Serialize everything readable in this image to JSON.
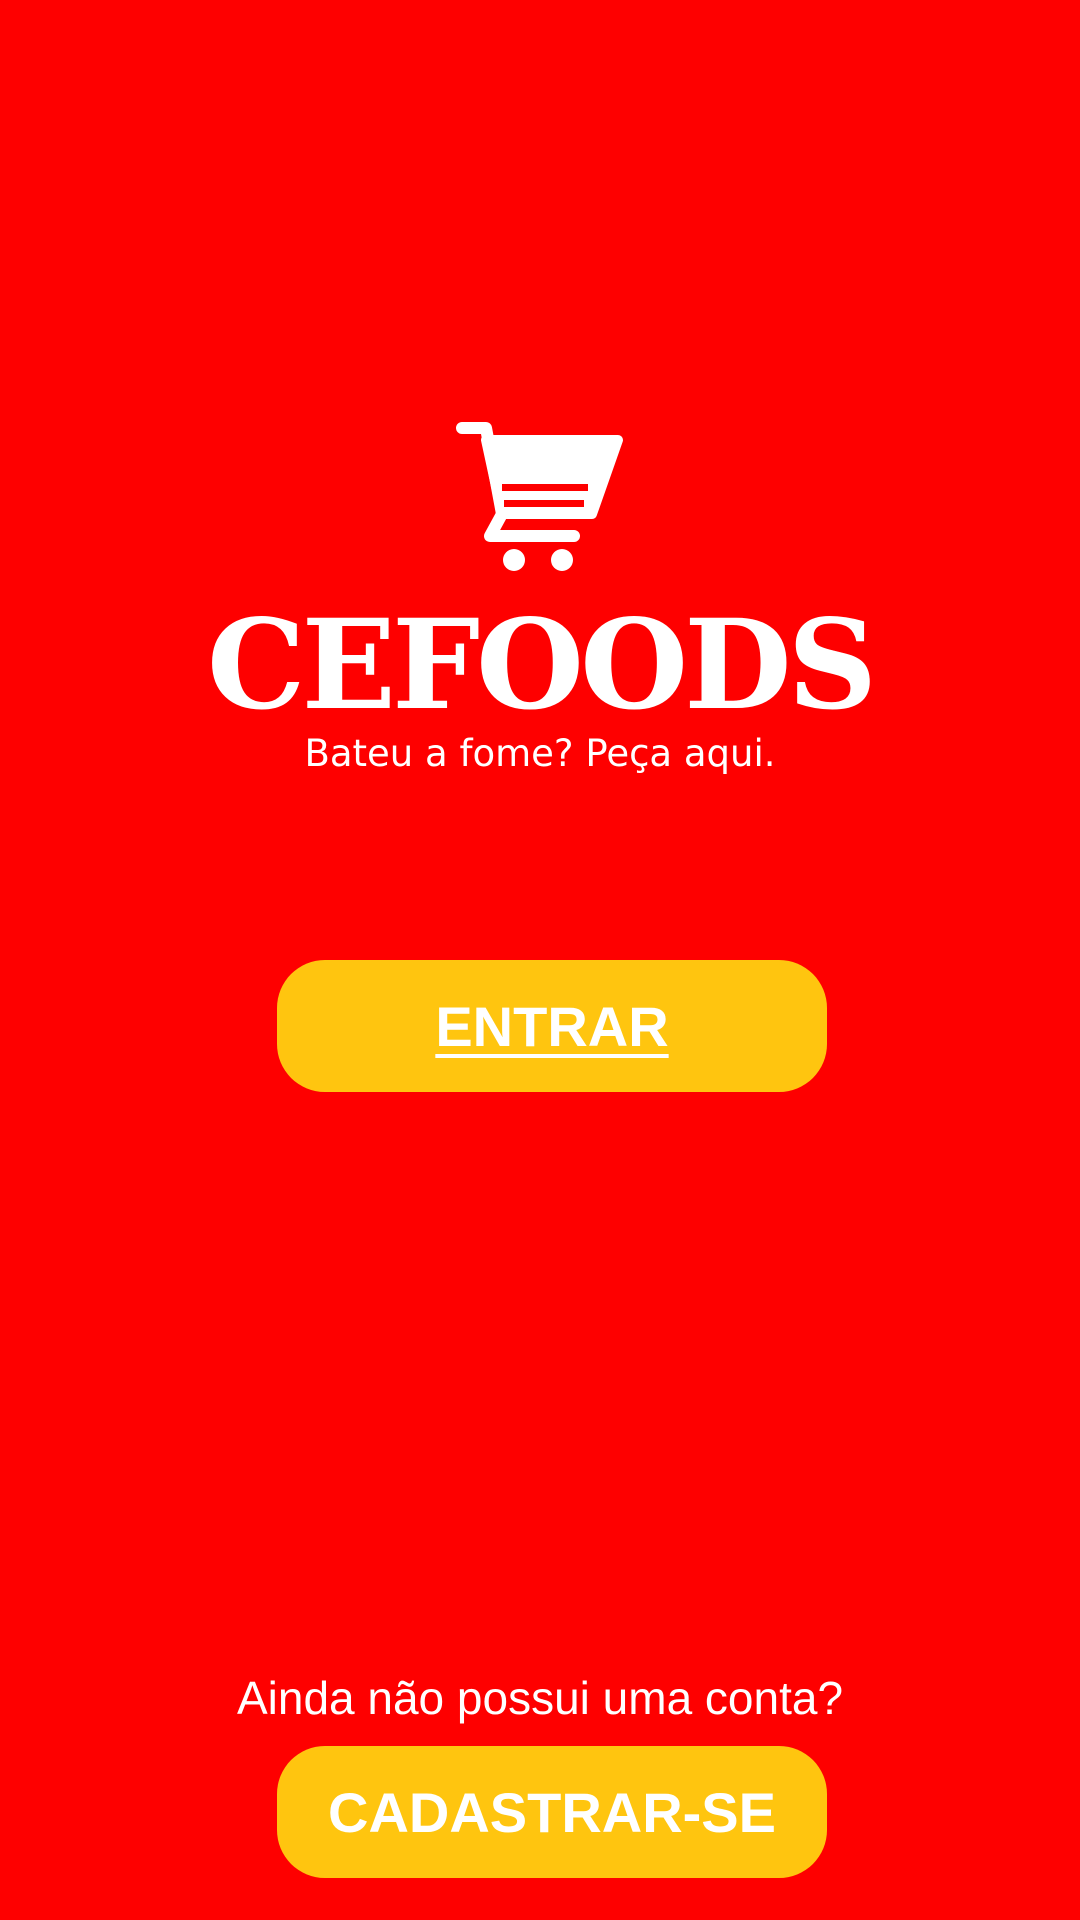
{
  "brand": {
    "name": "CEFOODS",
    "tagline": "Bateu a fome? Peça aqui.",
    "logo_icon": "shopping-cart-icon"
  },
  "actions": {
    "login_label": "ENTRAR",
    "signup_prompt": "Ainda não possui uma conta?",
    "signup_label": "CADASTRAR-SE"
  },
  "colors": {
    "background": "#fe0000",
    "button": "#ffc50f",
    "text": "#ffffff"
  }
}
